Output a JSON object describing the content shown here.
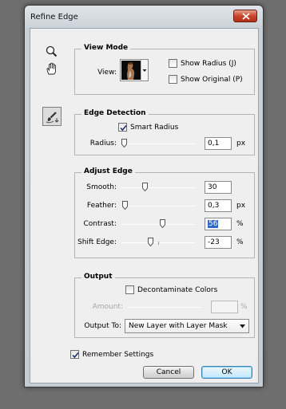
{
  "window": {
    "title": "Refine Edge"
  },
  "view_mode": {
    "title": "View Mode",
    "view_label": "View:",
    "show_radius": {
      "label": "Show Radius (J)",
      "checked": false
    },
    "show_original": {
      "label": "Show Original (P)",
      "checked": false
    }
  },
  "edge_detection": {
    "title": "Edge Detection",
    "smart_radius": {
      "label": "Smart Radius",
      "checked": true
    },
    "radius": {
      "label": "Radius:",
      "value": "0,1",
      "unit": "px",
      "level": 0.0
    }
  },
  "adjust_edge": {
    "title": "Adjust Edge",
    "smooth": {
      "label": "Smooth:",
      "value": "30",
      "unit": "",
      "level": 0.3
    },
    "feather": {
      "label": "Feather:",
      "value": "0,3",
      "unit": "px",
      "level": 0.01
    },
    "contrast": {
      "label": "Contrast:",
      "value": "56",
      "unit": "%",
      "level": 0.56
    },
    "shift_edge": {
      "label": "Shift Edge:",
      "value": "-23",
      "unit": "%",
      "level": 0.385
    }
  },
  "output": {
    "title": "Output",
    "decontaminate": {
      "label": "Decontaminate Colors",
      "checked": false
    },
    "amount": {
      "label": "Amount:",
      "value": "",
      "unit": "%"
    },
    "output_to": {
      "label": "Output To:",
      "selected": "New Layer with Layer Mask"
    }
  },
  "remember": {
    "label": "Remember Settings",
    "checked": true
  },
  "buttons": {
    "cancel": "Cancel",
    "ok": "OK"
  },
  "icons": {
    "zoom": "zoom-icon",
    "hand": "hand-icon",
    "refine_radius": "refine-radius-brush-icon"
  }
}
